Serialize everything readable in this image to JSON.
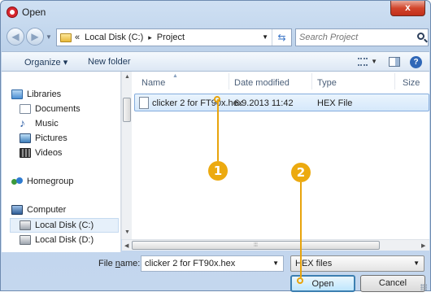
{
  "window": {
    "title": "Open",
    "close_label": "x"
  },
  "navigation": {
    "back_icon": "back-arrow-icon",
    "forward_icon": "forward-arrow-icon",
    "address": {
      "prefix": "«",
      "crumbs": [
        "Local Disk (C:)",
        "▸",
        "Project"
      ]
    },
    "search_placeholder": "Search Project"
  },
  "toolbar": {
    "organize_label": "Organize ▾",
    "new_folder_label": "New folder",
    "help_label": "?"
  },
  "nav_pane": {
    "items": [
      {
        "label": "Libraries",
        "icon": "libraries-icon"
      },
      {
        "label": "Documents",
        "icon": "documents-icon"
      },
      {
        "label": "Music",
        "icon": "music-icon"
      },
      {
        "label": "Pictures",
        "icon": "pictures-icon"
      },
      {
        "label": "Videos",
        "icon": "videos-icon"
      },
      {
        "label": "Homegroup",
        "icon": "homegroup-icon"
      },
      {
        "label": "Computer",
        "icon": "computer-icon"
      },
      {
        "label": "Local Disk (C:)",
        "icon": "local-disk-icon"
      },
      {
        "label": "Local Disk (D:)",
        "icon": "local-disk-icon"
      }
    ]
  },
  "file_list": {
    "columns": [
      "Name",
      "Date modified",
      "Type",
      "Size"
    ],
    "rows": [
      {
        "name": "clicker 2 for FT90x.hex",
        "date_modified": "6.9.2013 11:42",
        "type": "HEX File",
        "size": ""
      }
    ]
  },
  "bottom": {
    "file_name_label_prefix": "File ",
    "file_name_label_mnemonic": "n",
    "file_name_label_suffix": "ame:",
    "file_name_value": "clicker 2 for FT90x.hex",
    "file_type_value": "HEX files",
    "open_label": "Open",
    "cancel_label": "Cancel"
  },
  "callouts": [
    {
      "label": "1"
    },
    {
      "label": "2"
    }
  ],
  "colors": {
    "accent": "#ecaa10",
    "selection": "#d5e8fb",
    "window_frame": "#c4d7ee"
  }
}
